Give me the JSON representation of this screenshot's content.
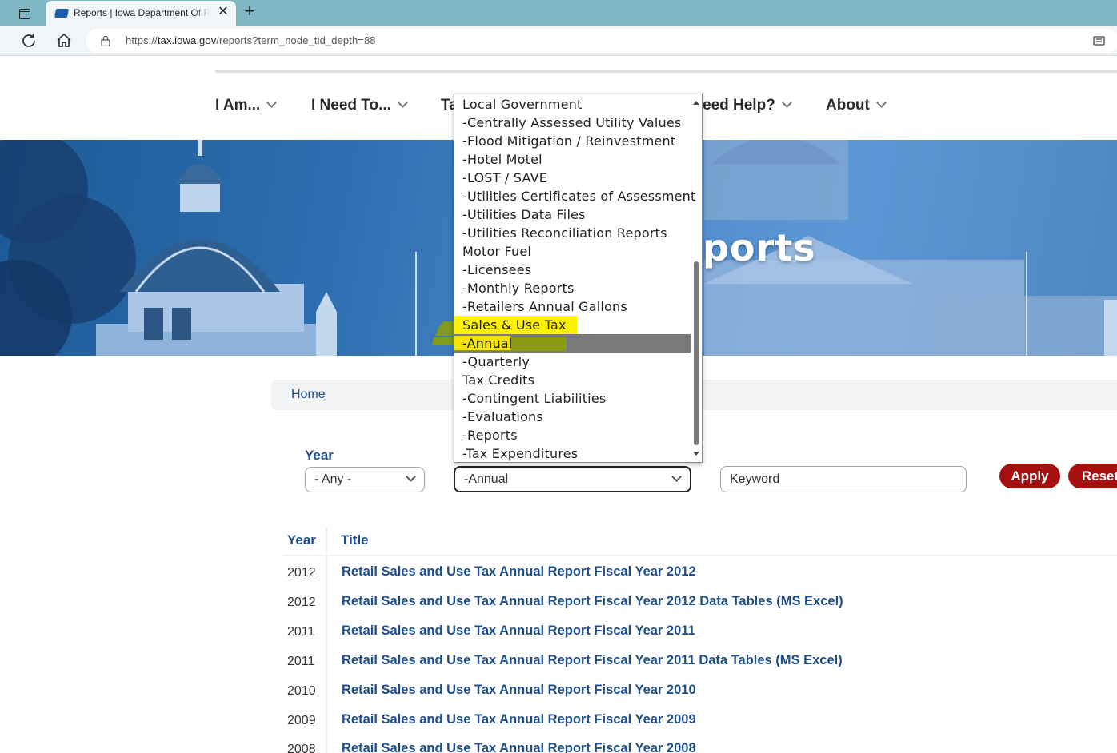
{
  "browser": {
    "tab_title": "Reports | Iowa Department Of Revenue",
    "url_prefix": "https://",
    "url_host": "tax.iowa.gov",
    "url_path": "/reports?term_node_tid_depth=88"
  },
  "nav": {
    "items": [
      "I Am...",
      "I Need To...",
      "Ta",
      "eed Help?",
      "About"
    ]
  },
  "hero": {
    "title": "ports"
  },
  "breadcrumb": {
    "home": "Home"
  },
  "filters": {
    "year_label": "Year",
    "year_value": "- Any -",
    "category_value": "-Annual",
    "keyword_placeholder": "Keyword",
    "apply": "Apply",
    "reset": "Reset"
  },
  "dropdown": {
    "options": [
      "Local Government",
      "-Centrally Assessed Utility Values",
      "-Flood Mitigation / Reinvestment",
      "-Hotel Motel",
      "-LOST / SAVE",
      "-Utilities Certificates of Assessment",
      "-Utilities Data Files",
      "-Utilities Reconciliation Reports",
      "Motor Fuel",
      "-Licensees",
      "-Monthly Reports",
      "-Retailers Annual Gallons",
      "Sales & Use Tax",
      "-Annual",
      "-Quarterly",
      "Tax Credits",
      "-Contingent Liabilities",
      "-Evaluations",
      "-Reports",
      "-Tax Expenditures"
    ],
    "highlighted": "Sales & Use Tax",
    "selected": "-Annual"
  },
  "table": {
    "headers": {
      "year": "Year",
      "title": "Title"
    },
    "rows": [
      {
        "year": "2012",
        "title": "Retail Sales and Use Tax Annual Report Fiscal Year 2012"
      },
      {
        "year": "2012",
        "title": "Retail Sales and Use Tax Annual Report Fiscal Year 2012 Data Tables (MS Excel)"
      },
      {
        "year": "2011",
        "title": "Retail Sales and Use Tax Annual Report Fiscal Year 2011"
      },
      {
        "year": "2011",
        "title": "Retail Sales and Use Tax Annual Report Fiscal Year 2011 Data Tables (MS Excel)"
      },
      {
        "year": "2010",
        "title": "Retail Sales and Use Tax Annual Report Fiscal Year 2010"
      },
      {
        "year": "2009",
        "title": "Retail Sales and Use Tax Annual Report Fiscal Year 2009"
      },
      {
        "year": "2008",
        "title": "Retail Sales and Use Tax Annual Report Fiscal Year 2008"
      }
    ]
  },
  "colors": {
    "brand_blue": "#1d4e89",
    "button_red": "#a50f0f",
    "highlight_yellow": "#fff200"
  }
}
